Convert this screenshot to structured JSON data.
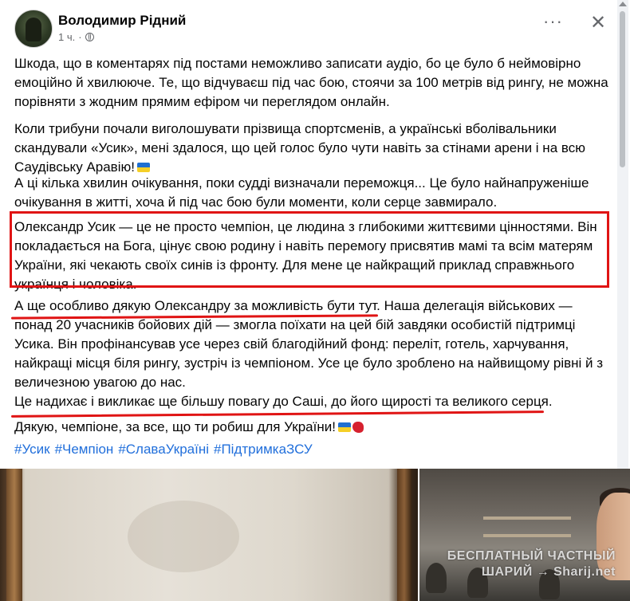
{
  "post": {
    "author": "Володимир Рідний",
    "time": "1 ч.",
    "paragraphs": [
      "Шкода, що в коментарях під постами неможливо записати аудіо, бо це було б неймовірно емоційно й хвилююче. Те, що відчуваєш під час бою, стоячи за 100 метрів від рингу, не можна порівняти з жодним прямим ефіром чи переглядом онлайн.",
      "Коли трибуни почали виголошувати прізвища спортсменів, а українські вболівальники скандували «Усик», мені здалося, що цей голос було чути навіть за стінами арени і на всю Саудівську Аравію!",
      "А ці кілька хвилин очікування, поки судді визначали переможця... Це було найнапруженіше очікування в житті, хоча й під час бою були моменти, коли серце завмирало.",
      "Олександр Усик — це не просто чемпіон, це людина з глибокими життєвими цінностями. Він покладається на Бога, цінує свою родину і навіть перемогу присвятив мамі та всім матерям України, які чекають своїх синів із фронту. Для мене це найкращий приклад справжнього українця і чоловіка.",
      "А ще особливо дякую Олександру за можливість бути тут. Наша делегація військових — понад 20 учасників бойових дій — змогла поїхати на цей бій завдяки особистій підтримці Усика. Він профінансував усе через свій благодійний фонд: переліт, готель, харчування, найкращі місця біля рингу, зустріч із чемпіоном. Усе це було зроблено на найвищому рівні й з величезною увагою до нас.",
      "Це надихає і викликає ще більшу повагу до Саші, до його щирості та великого серця.",
      "Дякую, чемпіоне, за все, що ти робиш для України!"
    ],
    "hashtags": [
      "#Усик",
      "#Чемпіон",
      "#СлаваУкраїні",
      "#ПідтримкаЗСУ"
    ]
  },
  "watermark": {
    "line1": "БЕСПЛАТНЫЙ ЧАСТНЫЙ",
    "line2": "ШАРИЙ → Sharij.net"
  },
  "colors": {
    "highlight": "#e01414",
    "hashtag": "#216fdb",
    "meta": "#65676b"
  },
  "icons": [
    "globe-icon",
    "more-options-icon",
    "close-icon",
    "ukraine-flag-icon",
    "boxing-glove-icon"
  ]
}
